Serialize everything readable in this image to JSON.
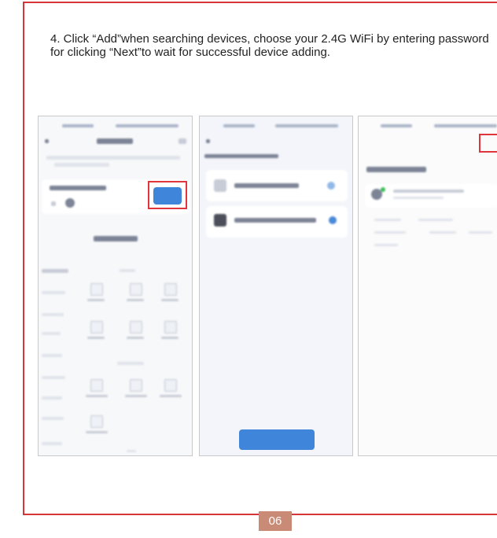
{
  "instructions": "4. Click “Add”when searching devices, choose your 2.4G WiFi by entering password for clicking “Next”to wait for successful device adding.",
  "page_number": "06",
  "colors": {
    "frame": "#d8353b",
    "highlight": "#e0353b",
    "accent_blue": "#3f86db",
    "page_badge": "#c98a76"
  }
}
